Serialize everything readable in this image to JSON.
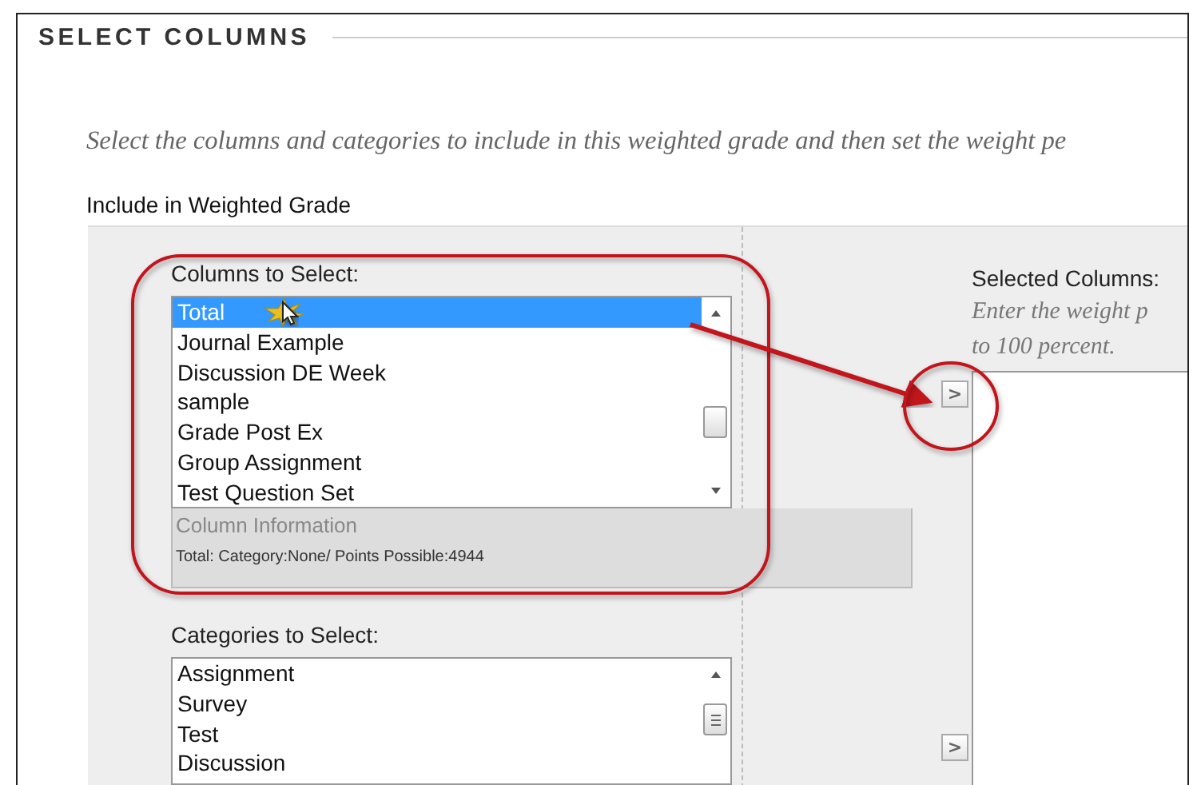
{
  "section": {
    "title": "SELECT COLUMNS"
  },
  "instructions": "Select the columns and categories to include in this weighted grade and then set the weight pe",
  "include_label": "Include in Weighted Grade",
  "columns_list": {
    "label": "Columns to Select:",
    "items": [
      {
        "label": "Total",
        "selected": true
      },
      {
        "label": "Journal Example",
        "selected": false
      },
      {
        "label": "Discussion DE Week",
        "selected": false
      },
      {
        "label": "sample",
        "selected": false
      },
      {
        "label": "Grade Post Ex",
        "selected": false
      },
      {
        "label": "Group Assignment",
        "selected": false
      },
      {
        "label": "Test Question Set",
        "selected": false
      }
    ]
  },
  "column_information": {
    "title": "Column Information",
    "text": "Total: Category:None/ Points Possible:4944"
  },
  "categories_list": {
    "label": "Categories to Select:",
    "items": [
      {
        "label": "Assignment",
        "selected": false
      },
      {
        "label": "Survey",
        "selected": false
      },
      {
        "label": "Test",
        "selected": false
      },
      {
        "label": "Discussion",
        "selected": false
      }
    ]
  },
  "selected_columns": {
    "label": "Selected Columns:",
    "hint_lines": [
      "Enter the weight p",
      "to 100 percent."
    ]
  },
  "add_buttons": [
    ">",
    ">"
  ]
}
